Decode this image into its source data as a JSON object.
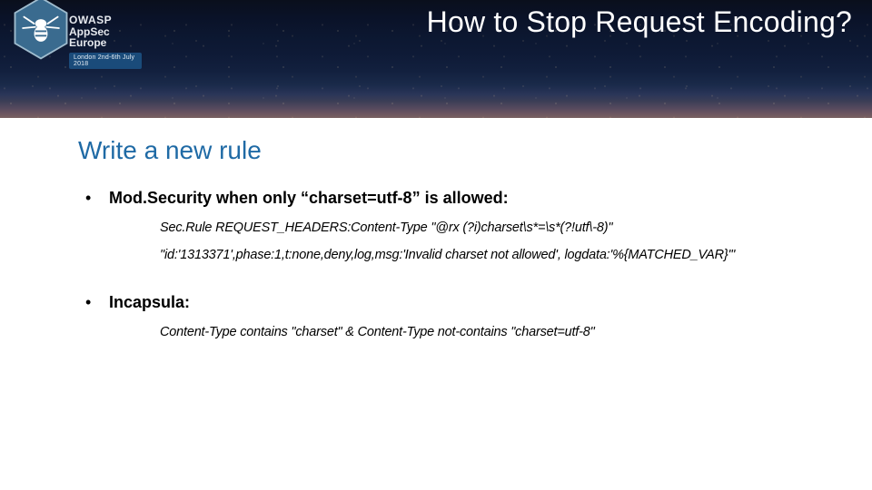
{
  "header": {
    "title": "How to Stop Request Encoding?",
    "badge": {
      "line1": "OWASP",
      "line2_prefix": "App",
      "line2_bold": "Sec",
      "line2_suffix": " Europe",
      "ribbon": "London 2nd-6th July 2018"
    }
  },
  "section_title": "Write a new rule",
  "items": [
    {
      "heading": "Mod.Security when only “charset=utf-8” is allowed:",
      "lines": [
        "Sec.Rule REQUEST_HEADERS:Content-Type \"@rx (?i)charset\\s*=\\s*(?!utf\\-8)\"",
        "\"id:'1313371',phase:1,t:none,deny,log,msg:'Invalid charset not allowed', logdata:'%{MATCHED_VAR}'\""
      ]
    },
    {
      "heading": "Incapsula:",
      "lines": [
        "Content-Type contains \"charset\" & Content-Type not-contains \"charset=utf-8\""
      ]
    }
  ]
}
